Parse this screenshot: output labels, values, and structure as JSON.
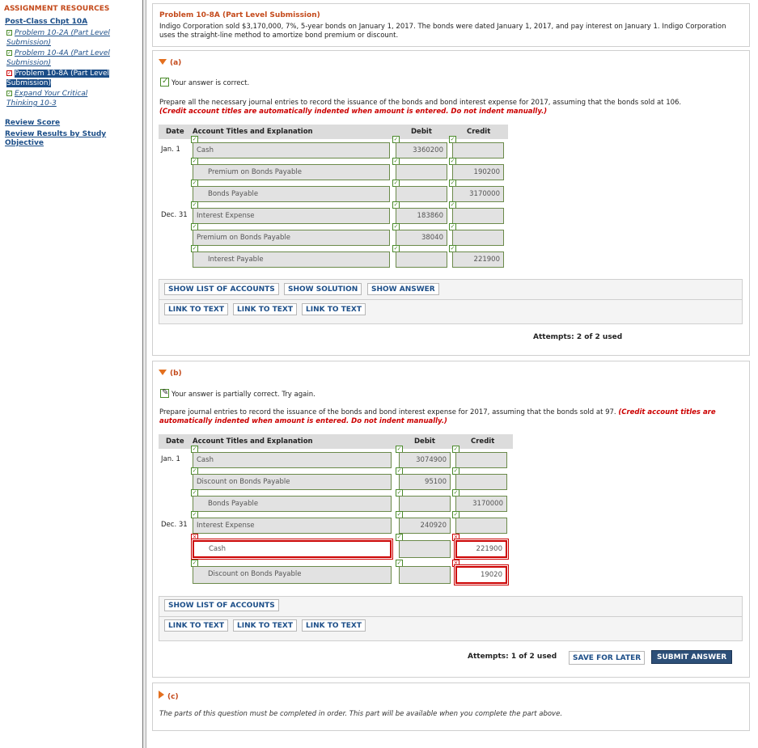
{
  "sidebar": {
    "title": "ASSIGNMENT RESOURCES",
    "chapter": "Post-Class Chpt 10A",
    "items": [
      {
        "label": "Problem 10-2A (Part Level Submission)"
      },
      {
        "label": "Problem 10-4A (Part Level Submission)"
      },
      {
        "label": "Problem 10-8A (Part Level Submission)"
      },
      {
        "label": "Expand Your Critical Thinking 10-3"
      }
    ],
    "review_score": "Review Score",
    "review_results": "Review Results by Study Objective"
  },
  "problem": {
    "title": "Problem 10-8A (Part Level Submission)",
    "description": "Indigo Corporation sold $3,170,000, 7%, 5-year bonds on January 1, 2017. The bonds were dated January 1, 2017, and pay interest on January 1. Indigo Corporation uses the straight-line method to amortize bond premium or discount."
  },
  "part_a": {
    "label": "(a)",
    "status": "Your answer is correct.",
    "instruction": "Prepare all the necessary journal entries to record the issuance of the bonds and bond interest expense for 2017, assuming that the bonds sold at 106.",
    "instruction_note": "(Credit account titles are automatically indented when amount is entered. Do not indent manually.)",
    "headers": {
      "date": "Date",
      "account": "Account Titles and Explanation",
      "debit": "Debit",
      "credit": "Credit"
    },
    "rows": [
      {
        "date": "Jan. 1",
        "account": "Cash",
        "debit": "3360200",
        "credit": ""
      },
      {
        "date": "",
        "account": "Premium on Bonds Payable",
        "debit": "",
        "credit": "190200"
      },
      {
        "date": "",
        "account": "Bonds Payable",
        "debit": "",
        "credit": "3170000"
      },
      {
        "date": "Dec. 31",
        "account": "Interest Expense",
        "debit": "183860",
        "credit": ""
      },
      {
        "date": "",
        "account": "Premium on Bonds Payable",
        "debit": "38040",
        "credit": ""
      },
      {
        "date": "",
        "account": "Interest Payable",
        "debit": "",
        "credit": "221900"
      }
    ],
    "buttons": {
      "show_list": "SHOW LIST OF ACCOUNTS",
      "show_solution": "SHOW SOLUTION",
      "show_answer": "SHOW ANSWER"
    },
    "links": [
      "LINK TO TEXT",
      "LINK TO TEXT",
      "LINK TO TEXT"
    ],
    "attempts": "Attempts: 2 of 2 used"
  },
  "part_b": {
    "label": "(b)",
    "status": "Your answer is partially correct.  Try again.",
    "instruction": "Prepare journal entries to record the issuance of the bonds and bond interest expense for 2017, assuming that the bonds sold at 97.",
    "instruction_note": "(Credit account titles are automatically indented when amount is entered. Do not indent manually.)",
    "headers": {
      "date": "Date",
      "account": "Account Titles and Explanation",
      "debit": "Debit",
      "credit": "Credit"
    },
    "rows": [
      {
        "date": "Jan. 1",
        "account": "Cash",
        "debit": "3074900",
        "credit": ""
      },
      {
        "date": "",
        "account": "Discount on Bonds Payable",
        "debit": "95100",
        "credit": ""
      },
      {
        "date": "",
        "account": "Bonds Payable",
        "debit": "",
        "credit": "3170000"
      },
      {
        "date": "Dec. 31",
        "account": "Interest Expense",
        "debit": "240920",
        "credit": ""
      },
      {
        "date": "",
        "account": "Cash",
        "debit": "",
        "credit": "221900"
      },
      {
        "date": "",
        "account": "Discount on Bonds Payable",
        "debit": "",
        "credit": "19020"
      }
    ],
    "buttons": {
      "show_list": "SHOW LIST OF ACCOUNTS"
    },
    "links": [
      "LINK TO TEXT",
      "LINK TO TEXT",
      "LINK TO TEXT"
    ],
    "attempts": "Attempts: 1 of 2 used",
    "save_label": "SAVE FOR LATER",
    "submit_label": "SUBMIT ANSWER"
  },
  "part_c": {
    "label": "(c)",
    "note": "The parts of this question must be completed in order. This part will be available when you complete the part above."
  },
  "colors": {
    "accent": "#c44a1b",
    "link": "#1c4e88",
    "error": "#cc0000",
    "correct": "#4a8a2a",
    "submit": "#2d4f78"
  }
}
